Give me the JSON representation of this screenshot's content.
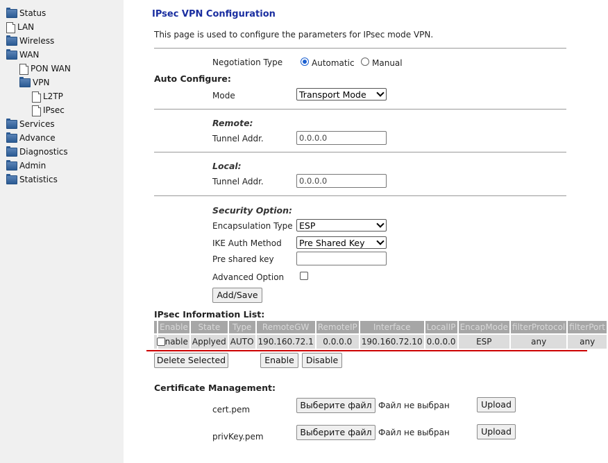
{
  "sidebar": {
    "items": [
      {
        "label": "Status",
        "icon": "folder"
      },
      {
        "label": "LAN",
        "icon": "document"
      },
      {
        "label": "Wireless",
        "icon": "folder"
      },
      {
        "label": "WAN",
        "icon": "folder"
      },
      {
        "label": "PON WAN",
        "icon": "document"
      },
      {
        "label": "VPN",
        "icon": "folder"
      },
      {
        "label": "L2TP",
        "icon": "document"
      },
      {
        "label": "IPsec",
        "icon": "document"
      },
      {
        "label": "Services",
        "icon": "folder"
      },
      {
        "label": "Advance",
        "icon": "folder"
      },
      {
        "label": "Diagnostics",
        "icon": "folder"
      },
      {
        "label": "Admin",
        "icon": "folder"
      },
      {
        "label": "Statistics",
        "icon": "folder"
      }
    ]
  },
  "page": {
    "title": "IPsec VPN Configuration",
    "description": "This page is used to configure the parameters for IPsec mode VPN."
  },
  "negotiation": {
    "label": "Negotiation Type",
    "options": [
      "Automatic",
      "Manual"
    ],
    "selected": "Automatic"
  },
  "auto_configure": {
    "heading": "Auto Configure:",
    "mode_label": "Mode",
    "mode_value": "Transport Mode"
  },
  "remote": {
    "heading": "Remote:",
    "tunnel_label": "Tunnel Addr.",
    "tunnel_value": "0.0.0.0"
  },
  "local": {
    "heading": "Local:",
    "tunnel_label": "Tunnel Addr.",
    "tunnel_value": "0.0.0.0"
  },
  "security": {
    "heading": "Security Option:",
    "encap_label": "Encapsulation Type",
    "encap_value": "ESP",
    "ike_label": "IKE Auth Method",
    "ike_value": "Pre Shared Key",
    "psk_label": "Pre shared key",
    "psk_value": "",
    "advanced_label": "Advanced Option",
    "advanced_checked": false,
    "add_save": "Add/Save"
  },
  "info_list": {
    "heading": "IPsec Information List:",
    "columns": [
      "",
      "Enable",
      "State",
      "Type",
      "RemoteGW",
      "RemoteIP",
      "Interface",
      "LocalIP",
      "EncapMode",
      "filterProtocol",
      "filterPort"
    ],
    "rows": [
      {
        "enable": "Enable",
        "state": "Applyed",
        "type": "AUTO",
        "remote_gw": "190.160.72.1",
        "remote_ip": "0.0.0.0",
        "interface": "190.160.72.10",
        "local_ip": "0.0.0.0",
        "encap_mode": "ESP",
        "filter_protocol": "any",
        "filter_port": "any"
      }
    ],
    "delete_button": "Delete Selected",
    "enable_button": "Enable",
    "disable_button": "Disable"
  },
  "certificate": {
    "heading": "Certificate Management:",
    "cert_label": "cert.pem",
    "key_label": "privKey.pem",
    "choose_button": "Выберите файл",
    "no_file": "Файл не выбран",
    "upload_button": "Upload"
  },
  "colors": {
    "title": "#1a2ea0",
    "sidebar_bg": "#f0f0f0",
    "table_header": "#a6a6a6",
    "table_cell": "#dcdcdc",
    "accent_line": "#cc0000"
  }
}
